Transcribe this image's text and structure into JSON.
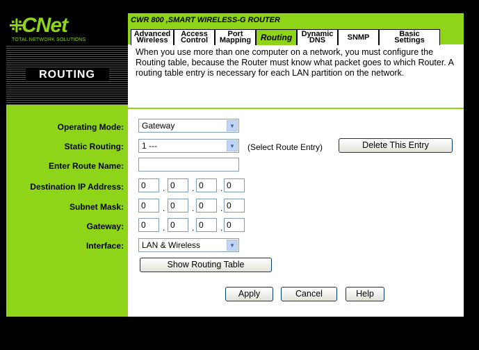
{
  "brand": {
    "logo_text": "CNet",
    "logo_tagline": "TOTAL NETWORK SOLUTIONS"
  },
  "product_title": "CWR 800 ,SMART WIRELESS-G ROUTER",
  "tabs": [
    {
      "line1": "Advanced",
      "line2": "Wireless"
    },
    {
      "line1": "Access",
      "line2": "Control"
    },
    {
      "line1": "Port",
      "line2": "Mapping"
    },
    {
      "line1": "Routing",
      "line2": ""
    },
    {
      "line1": "Dynamic",
      "line2": "DNS"
    },
    {
      "line1": "SNMP",
      "line2": ""
    },
    {
      "line1": "Basic",
      "line2": "Settings"
    }
  ],
  "section_title": "ROUTING",
  "description": "When you use more than one computer on a network, you must configure the Routing table, because the Router must know what packet goes to which Router. A routing table entry is necessary for each LAN partition on the network.",
  "labels": {
    "operating_mode": "Operating Mode:",
    "static_routing": "Static Routing:",
    "route_name": "Enter Route Name:",
    "dest_ip": "Destination IP Address:",
    "subnet": "Subnet Mask:",
    "gateway": "Gateway:",
    "interface": "Interface:"
  },
  "values": {
    "operating_mode": "Gateway",
    "static_routing": "1 ---",
    "route_name": "",
    "dest_ip": [
      "0",
      "0",
      "0",
      "0"
    ],
    "subnet": [
      "0",
      "0",
      "0",
      "0"
    ],
    "gateway": [
      "0",
      "0",
      "0",
      "0"
    ],
    "interface": "LAN & Wireless"
  },
  "select_route_note": "(Select Route Entry)",
  "buttons": {
    "delete_entry": "Delete This Entry",
    "show_table": "Show Routing Table",
    "apply": "Apply",
    "cancel": "Cancel",
    "help": "Help"
  },
  "icons": {
    "dropdown": "chevron-down-icon"
  }
}
